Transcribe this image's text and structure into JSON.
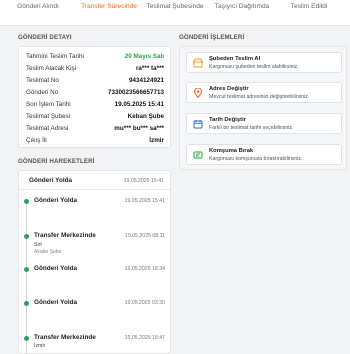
{
  "steps": [
    {
      "label": "Gönderi Alındı"
    },
    {
      "label": "Transfer Sürecinde",
      "active": true
    },
    {
      "label": "Teslimat Şubesinde"
    },
    {
      "label": "Taşıyıcı Dağıtımda"
    },
    {
      "label": "Teslim Edildi"
    }
  ],
  "detail": {
    "title": "GÖNDERİ DETAYI",
    "rows": [
      {
        "label": "Tahmini Teslim Tarihi",
        "value": "20 Mayıs Salı"
      },
      {
        "label": "Teslim Alacak Kişi",
        "value": "ra*** ta***"
      },
      {
        "label": "Teslimat No",
        "value": "9434124921"
      },
      {
        "label": "Gönderi No",
        "value": "7330023566657713"
      },
      {
        "label": "Son İşlem Tarihi",
        "value": "19.05.2025 15:41"
      },
      {
        "label": "Teslimat Şubesi",
        "value": "Keban Şube"
      },
      {
        "label": "Teslimat Adresi",
        "value": "mu*** bu*** sa***"
      },
      {
        "label": "Çıkış İli",
        "value": "İzmir"
      }
    ]
  },
  "operations": {
    "title": "GÖNDERİ İŞLEMLERİ",
    "items": [
      {
        "title": "Şubeden Teslim Al",
        "desc": "Kargonuzu şubeden teslim alabilirsiniz.",
        "icon": "store-icon"
      },
      {
        "title": "Adres Değiştir",
        "desc": "Mevcut teslimat adresinizi değiştirebilirsiniz.",
        "icon": "location-pin-icon"
      },
      {
        "title": "Tarih Değiştir",
        "desc": "Farklı bir teslimat tarihi seçebilirsiniz.",
        "icon": "calendar-icon"
      },
      {
        "title": "Komşuma Bırak",
        "desc": "Kargonuzu komşunuza bıraktırabilirsiniz.",
        "icon": "neighbor-icon"
      }
    ]
  },
  "movements": {
    "title": "GÖNDERİ HAREKETLERİ",
    "items": [
      {
        "title": "Gönderi Yolda",
        "date": "19.05.2025 15:41"
      },
      {
        "title": "Gönderi Yolda",
        "date": "19.05.2025 15:41"
      },
      {
        "title": "Transfer Merkezinde",
        "date": "19.05.2025 08:11",
        "sub": "Sirt",
        "sub2": "Akabe Şube"
      },
      {
        "title": "Gönderi Yolda",
        "date": "16.05.2025 18:34"
      },
      {
        "title": "Gönderi Yolda",
        "date": "16.05.2025 03:30"
      },
      {
        "title": "Transfer Merkezinde",
        "date": "15.05.2025 18:47",
        "sub": "İzmir"
      }
    ]
  },
  "colors": {
    "accent": "#f26a21",
    "success": "#27a745"
  }
}
